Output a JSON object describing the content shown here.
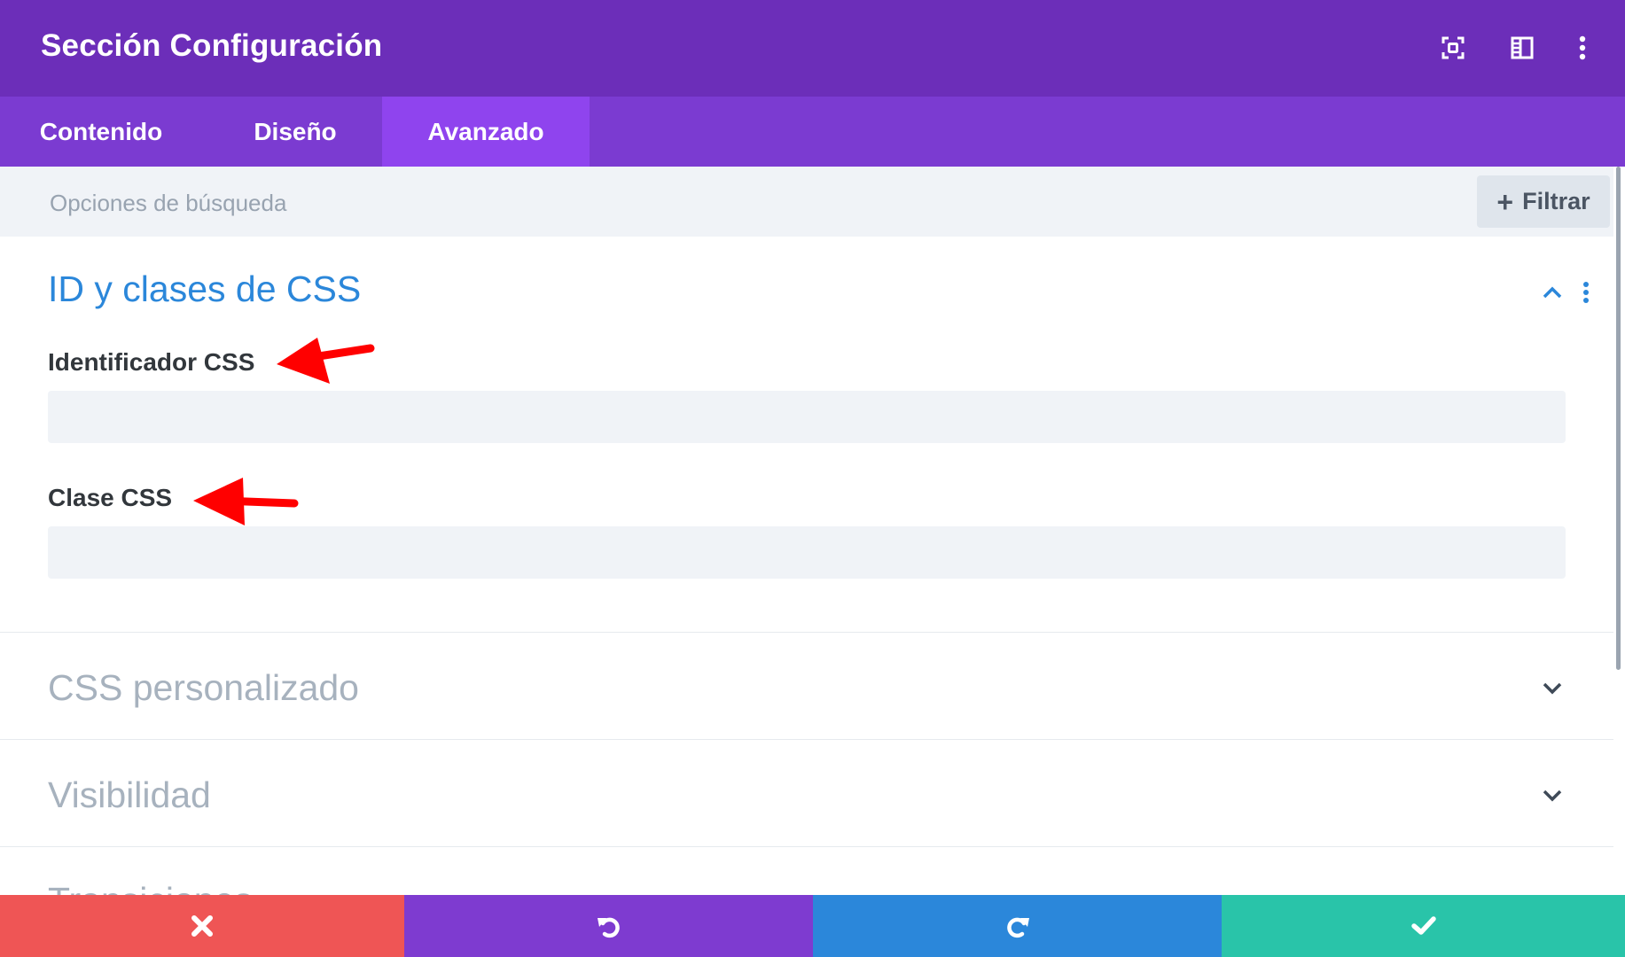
{
  "header": {
    "title": "Sección Configuración",
    "icons": [
      "focus-icon",
      "split-view-icon",
      "more-options-icon"
    ]
  },
  "tabs": [
    {
      "label": "Contenido",
      "active": false
    },
    {
      "label": "Diseño",
      "active": false
    },
    {
      "label": "Avanzado",
      "active": true
    }
  ],
  "search": {
    "placeholder": "Opciones de búsqueda",
    "value": "",
    "filter_label": "Filtrar"
  },
  "sections": {
    "css_ids": {
      "title": "ID y clases de CSS",
      "expanded": true,
      "fields": [
        {
          "label": "Identificador CSS",
          "value": ""
        },
        {
          "label": "Clase CSS",
          "value": ""
        }
      ]
    },
    "custom_css": {
      "title": "CSS personalizado",
      "expanded": false
    },
    "visibility": {
      "title": "Visibilidad",
      "expanded": false
    },
    "transitions": {
      "title": "Transiciones",
      "expanded": false
    }
  },
  "footer": {
    "buttons": [
      {
        "name": "cancel",
        "icon": "close-icon",
        "color": "#ef5555"
      },
      {
        "name": "undo",
        "icon": "undo-icon",
        "color": "#7e3bd0"
      },
      {
        "name": "redo",
        "icon": "redo-icon",
        "color": "#2b87da"
      },
      {
        "name": "save",
        "icon": "check-icon",
        "color": "#29c4a9"
      }
    ]
  },
  "colors": {
    "header": "#6c2eb9",
    "tabs": "#7b3bd1",
    "tab_active": "#8f44ee",
    "accent_blue": "#2b87da",
    "annotation_arrow": "#ff0000"
  }
}
